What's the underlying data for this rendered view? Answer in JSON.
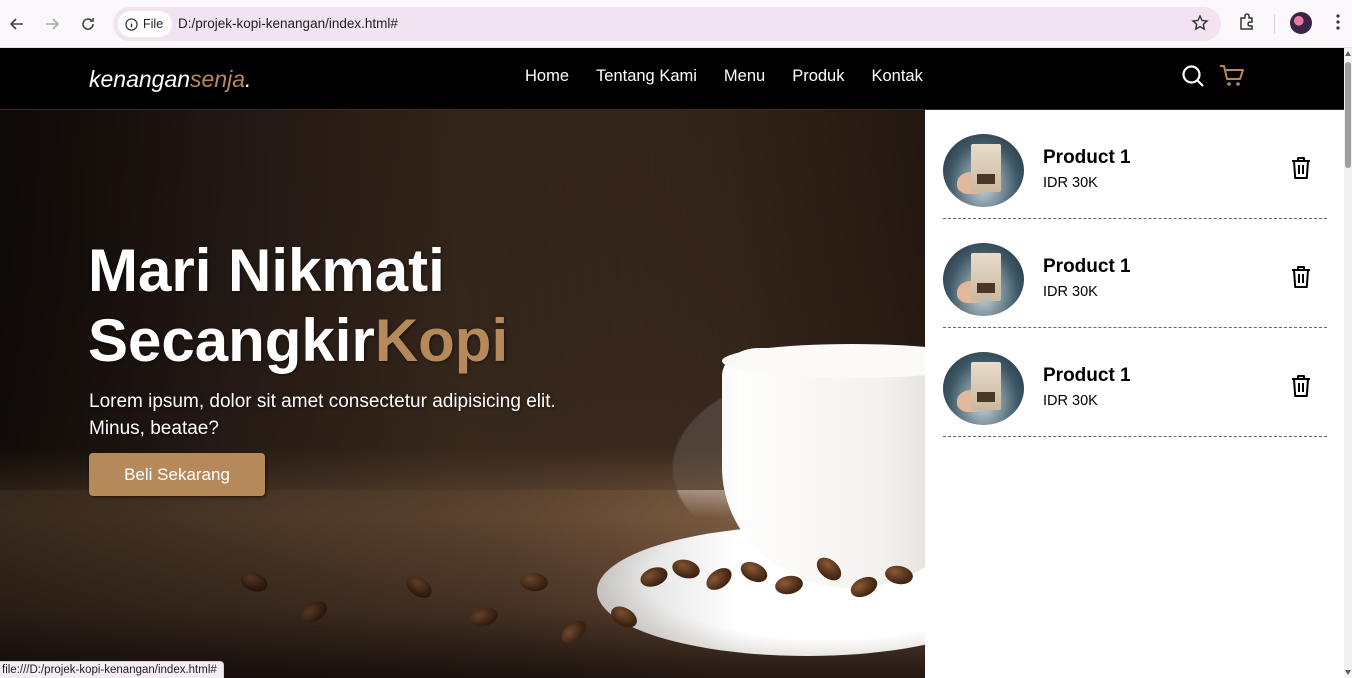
{
  "browser": {
    "file_chip_label": "File",
    "url": "D:/projek-kopi-kenangan/index.html#",
    "status_url": "file:///D:/projek-kopi-kenangan/index.html#"
  },
  "navbar": {
    "brand_main": "kenangan",
    "brand_accent": "senja",
    "brand_dot": ".",
    "links": [
      "Home",
      "Tentang Kami",
      "Menu",
      "Produk",
      "Kontak"
    ]
  },
  "hero": {
    "title_line1": "Mari Nikmati",
    "title_line2_main": "Secangkir",
    "title_line2_accent": "Kopi",
    "description": "Lorem ipsum, dolor sit amet consectetur adipisicing elit. Minus, beatae?",
    "cta_label": "Beli Sekarang"
  },
  "cart": {
    "items": [
      {
        "name": "Product 1",
        "price": "IDR 30K"
      },
      {
        "name": "Product 1",
        "price": "IDR 30K"
      },
      {
        "name": "Product 1",
        "price": "IDR 30K"
      }
    ]
  },
  "colors": {
    "accent": "#b6895b",
    "navbar_bg": "#010101"
  }
}
